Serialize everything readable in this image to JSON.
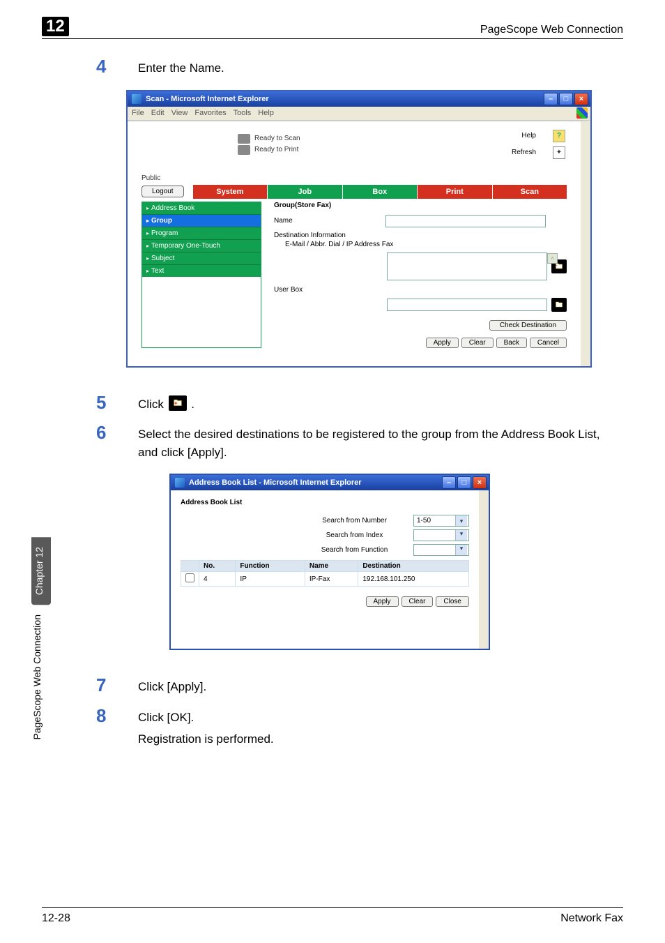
{
  "header": {
    "chapter_number": "12",
    "title": "PageScope Web Connection"
  },
  "steps": {
    "s4": {
      "num": "4",
      "text": "Enter the Name."
    },
    "s5": {
      "num": "5",
      "text_before": "Click ",
      "text_after": "."
    },
    "s6": {
      "num": "6",
      "text": "Select the desired destinations to be registered to the group from the Address Book List, and click [Apply]."
    },
    "s7": {
      "num": "7",
      "text": "Click [Apply]."
    },
    "s8": {
      "num": "8",
      "text": "Click [OK]."
    },
    "s8_follow": "Registration is performed."
  },
  "ie_window": {
    "title": "Scan - Microsoft Internet Explorer",
    "menu": [
      "File",
      "Edit",
      "View",
      "Favorites",
      "Tools",
      "Help"
    ],
    "status1": "Ready to Scan",
    "status2": "Ready to Print",
    "help_label": "Help",
    "refresh_label": "Refresh",
    "public": "Public",
    "logout": "Logout",
    "tabs": [
      "System",
      "Job",
      "Box",
      "Print",
      "Scan"
    ],
    "nav": [
      "Address Book",
      "Group",
      "Program",
      "Temporary One-Touch",
      "Subject",
      "Text"
    ],
    "panel_title": "Group(Store Fax)",
    "name_label": "Name",
    "dest_info": "Destination Information",
    "dest_sub": "E-Mail / Abbr. Dial / IP Address Fax",
    "userbox": "User Box",
    "check_destination": "Check Destination",
    "buttons": {
      "apply": "Apply",
      "clear": "Clear",
      "back": "Back",
      "cancel": "Cancel"
    }
  },
  "abl_window": {
    "title": "Address Book List - Microsoft Internet Explorer",
    "header": "Address Book List",
    "search_number": "Search from Number",
    "search_index": "Search from Index",
    "search_function": "Search from Function",
    "number_range": "1-50",
    "columns": {
      "no": "No.",
      "function": "Function",
      "name": "Name",
      "destination": "Destination"
    },
    "row": {
      "no": "4",
      "function": "IP",
      "name": "IP-Fax",
      "destination": "192.168.101.250"
    },
    "buttons": {
      "apply": "Apply",
      "clear": "Clear",
      "close": "Close"
    }
  },
  "side_tab": {
    "chapter": "Chapter 12",
    "label": "PageScope Web Connection"
  },
  "footer": {
    "page": "12-28",
    "title": "Network Fax"
  }
}
